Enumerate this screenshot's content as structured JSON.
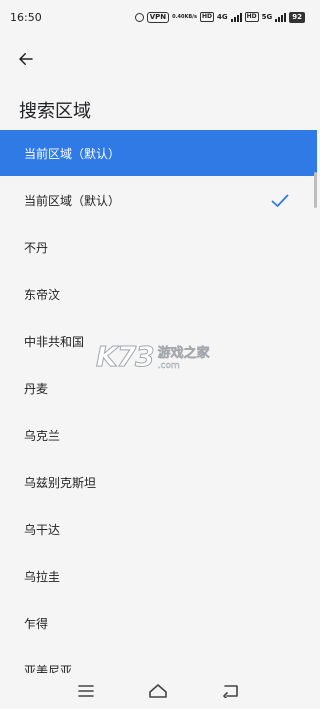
{
  "status_bar": {
    "time": "16:50",
    "vpn": "VPN",
    "speed_value": "0.40",
    "speed_unit": "KB/s",
    "hd1": "HD",
    "net1": "4G",
    "hd2": "HD",
    "net2": "5G",
    "battery": "92"
  },
  "header": {
    "title": "搜索区域"
  },
  "selected_banner": "当前区域（默认）",
  "regions": [
    {
      "label": "当前区域（默认）",
      "checked": true
    },
    {
      "label": "不丹"
    },
    {
      "label": "东帝汶"
    },
    {
      "label": "中非共和国"
    },
    {
      "label": "丹麦"
    },
    {
      "label": "乌克兰"
    },
    {
      "label": "乌兹别克斯坦"
    },
    {
      "label": "乌干达"
    },
    {
      "label": "乌拉圭"
    },
    {
      "label": "乍得"
    },
    {
      "label": "亚美尼亚"
    }
  ],
  "watermark": {
    "logo": "K73",
    "cn": "游戏之家",
    "en": ".com"
  },
  "icons": {
    "back": "arrow-left-icon",
    "check": "check-icon",
    "menu": "menu-icon",
    "home": "home-icon",
    "return": "return-icon"
  },
  "colors": {
    "accent": "#2f7ae5",
    "background": "#f5f5f5"
  }
}
